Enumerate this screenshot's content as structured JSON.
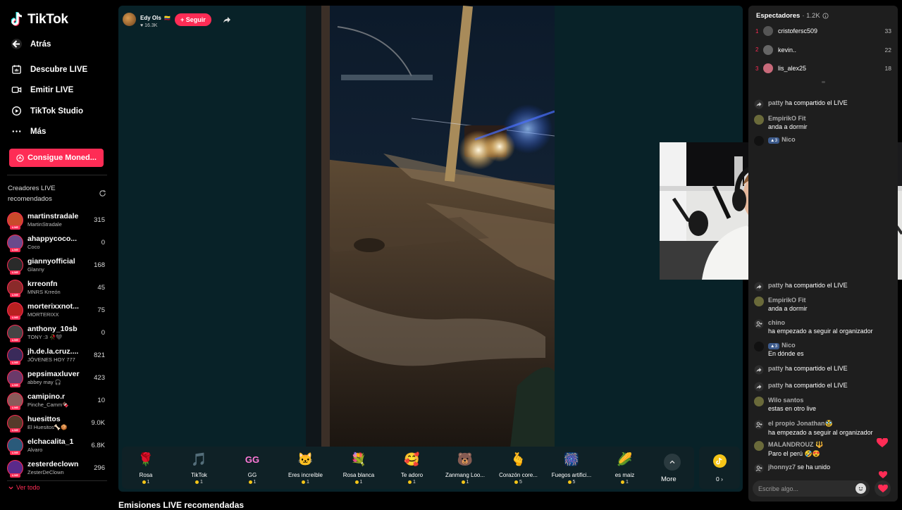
{
  "app": {
    "brand": "TikTok",
    "accent": "#fe2c55"
  },
  "sidebar": {
    "back_label": "Atrás",
    "nav": [
      {
        "label": "Descubre LIVE",
        "icon": "calendar-live-icon"
      },
      {
        "label": "Emitir LIVE",
        "icon": "camera-icon"
      },
      {
        "label": "TikTok Studio",
        "icon": "studio-icon"
      },
      {
        "label": "Más",
        "icon": "more-dots-icon"
      }
    ],
    "coins_button": "Consigue Moned...",
    "section_title": "Creadores LIVE recomendados",
    "creators": [
      {
        "name": "martinstradale",
        "sub": "MartinStradale",
        "count": "315"
      },
      {
        "name": "ahappycoco...",
        "sub": "Coco",
        "count": "0"
      },
      {
        "name": "giannyofficial",
        "sub": "Glanny",
        "count": "168"
      },
      {
        "name": "krreonfn",
        "sub": "MNRS Krreón",
        "count": "45"
      },
      {
        "name": "morterixxnot...",
        "sub": "MORTERIXX",
        "count": "75"
      },
      {
        "name": "anthony_10sb",
        "sub": "TONY :3 🥀🖤",
        "count": "0"
      },
      {
        "name": "jh.de.la.cruz....",
        "sub": "JÓVENES HOY 777",
        "count": "821"
      },
      {
        "name": "pepsimaxluver",
        "sub": "abbey may 🎧",
        "count": "423"
      },
      {
        "name": "camipino.r",
        "sub": "Pinche_Camm🍫",
        "count": "10"
      },
      {
        "name": "huesittos",
        "sub": "El Huesitos🦴🍪",
        "count": "9.0K"
      },
      {
        "name": "elchacalita_1",
        "sub": "Alvaro",
        "count": "6.8K"
      },
      {
        "name": "zesterdeclown",
        "sub": "ZesterDeClown",
        "count": "296"
      }
    ],
    "see_all": "Ver todo"
  },
  "stream": {
    "host_name": "Edy Ols",
    "host_flag": "🇨🇴",
    "host_likes": "16.3K",
    "follow_label": "+ Seguir"
  },
  "gifts": [
    {
      "name": "Rosa",
      "price": "1",
      "emoji": "🌹"
    },
    {
      "name": "TikTok",
      "price": "1",
      "emoji": "🎵"
    },
    {
      "name": "GG",
      "price": "1",
      "emoji": "GG"
    },
    {
      "name": "Eres increíble",
      "price": "1",
      "emoji": "🐱"
    },
    {
      "name": "Rosa blanca",
      "price": "1",
      "emoji": "💐"
    },
    {
      "name": "Te adoro",
      "price": "1",
      "emoji": "🥰"
    },
    {
      "name": "Zanmang Loo...",
      "price": "1",
      "emoji": "🐻"
    },
    {
      "name": "Corazón core...",
      "price": "5",
      "emoji": "🫰"
    },
    {
      "name": "Fuegos artifici...",
      "price": "5",
      "emoji": "🎆"
    },
    {
      "name": "es maiz",
      "price": "1",
      "emoji": "🌽"
    }
  ],
  "more_label": "More",
  "wallet_balance": "0",
  "recommended_title": "Emisiones LIVE recomendadas",
  "panel": {
    "viewers_title": "Espectadores",
    "viewers_count": "· 1.2K",
    "top_viewers": [
      {
        "rank": "1",
        "name": "cristofersc509",
        "score": "33"
      },
      {
        "rank": "2",
        "name": "kevin..",
        "score": "22"
      },
      {
        "rank": "3",
        "name": "lis_alex25",
        "score": "18"
      }
    ],
    "chat_top": [
      {
        "user": "patty",
        "text": "ha compartido el LIVE"
      },
      {
        "user": "EmpirikO Fit",
        "text": "anda a dormir"
      },
      {
        "badge": "3",
        "user": "Nico",
        "text": ""
      }
    ],
    "chat": [
      {
        "user": "patty",
        "text": "ha compartido el LIVE"
      },
      {
        "user": "EmpirikO Fit",
        "text": "anda a dormir"
      },
      {
        "user": "chino",
        "text": "ha empezado a seguir al organizador"
      },
      {
        "badge": "3",
        "user": "Nico",
        "text": "En dónde es"
      },
      {
        "user": "patty",
        "text": "ha compartido el LIVE"
      },
      {
        "user": "patty",
        "text": "ha compartido el LIVE"
      },
      {
        "user": "Wilo santos",
        "text": "estas en otro live"
      },
      {
        "user": "el propio Jonathan🥸",
        "text": "ha empezado a seguir al organizador"
      },
      {
        "user": "MALANDROUZ 🔱",
        "text": "Paro el perú 🤣😍"
      },
      {
        "user": "jhonnyz7",
        "text": "se ha unido"
      }
    ],
    "input_placeholder": "Escribe algo..."
  }
}
